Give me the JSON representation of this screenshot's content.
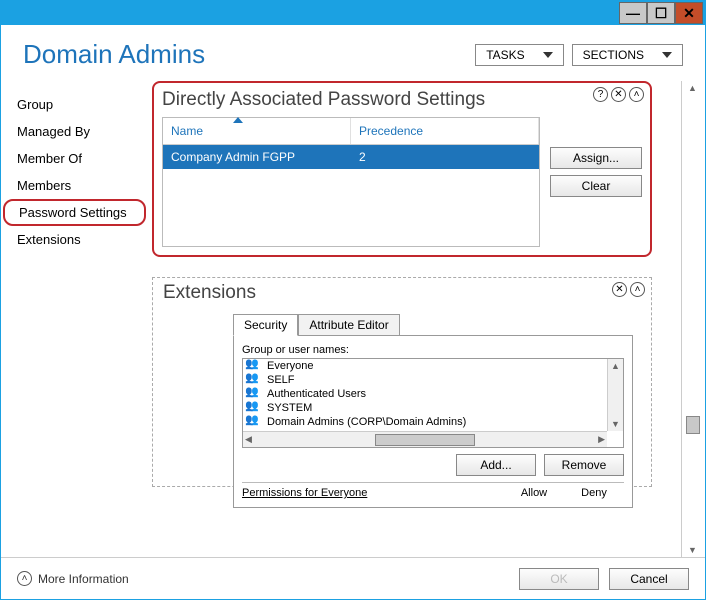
{
  "header": {
    "title": "Domain Admins",
    "tasks_label": "TASKS",
    "sections_label": "SECTIONS"
  },
  "sidebar": {
    "items": [
      {
        "label": "Group"
      },
      {
        "label": "Managed By"
      },
      {
        "label": "Member Of"
      },
      {
        "label": "Members"
      },
      {
        "label": "Password Settings"
      },
      {
        "label": "Extensions"
      }
    ]
  },
  "pso_panel": {
    "title": "Directly Associated Password Settings",
    "col_name": "Name",
    "col_prec": "Precedence",
    "rows": [
      {
        "name": "Company Admin FGPP",
        "precedence": "2"
      }
    ],
    "assign_label": "Assign...",
    "clear_label": "Clear"
  },
  "ext_panel": {
    "title": "Extensions",
    "tab_security": "Security",
    "tab_attr": "Attribute Editor",
    "group_label": "Group or user names:",
    "listbox": [
      "Everyone",
      "SELF",
      "Authenticated Users",
      "SYSTEM",
      "Domain Admins (CORP\\Domain Admins)"
    ],
    "add_label": "Add...",
    "remove_label": "Remove",
    "perms_label": "Permissions for Everyone",
    "allow": "Allow",
    "deny": "Deny"
  },
  "footer": {
    "more_info": "More Information",
    "ok": "OK",
    "cancel": "Cancel"
  }
}
